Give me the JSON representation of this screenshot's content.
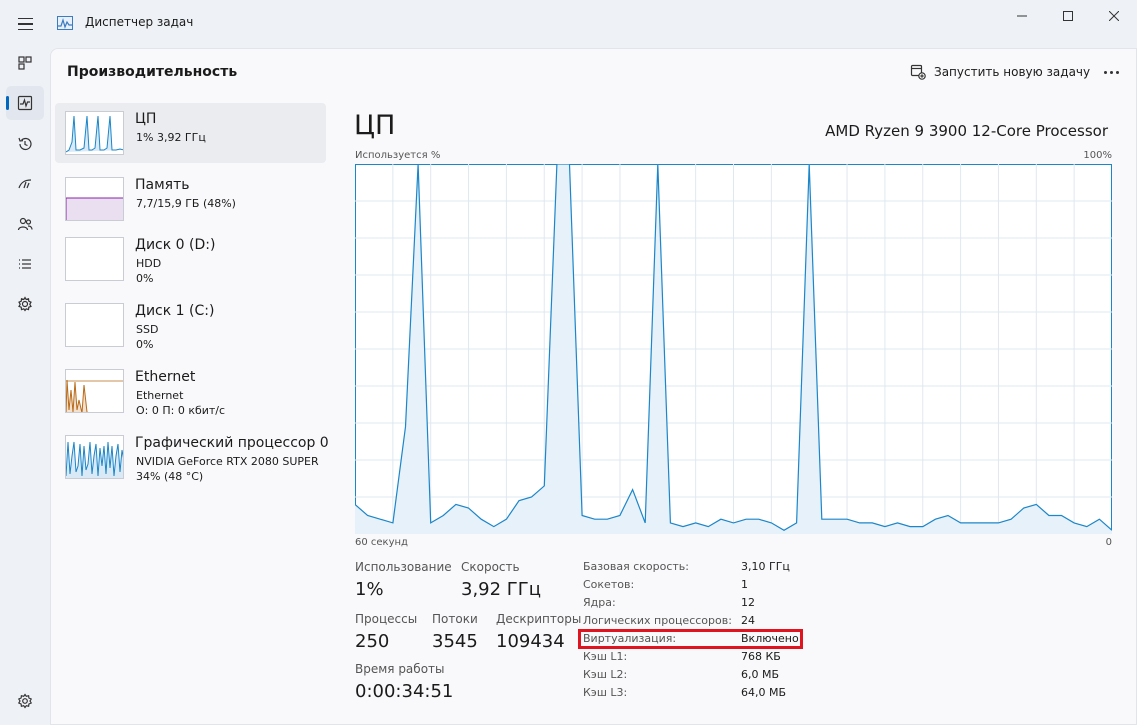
{
  "window": {
    "title": "Диспетчер задач"
  },
  "nav": {
    "items": [
      "processes-icon",
      "performance-icon",
      "app-history-icon",
      "startup-apps-icon",
      "users-icon",
      "details-icon",
      "services-icon"
    ],
    "active": "performance-icon",
    "settings": "settings-icon"
  },
  "header": {
    "title": "Производительность",
    "run_new_task": "Запустить новую задачу"
  },
  "devices": [
    {
      "name": "ЦП",
      "line1": "1% 3,92 ГГц",
      "line2": ""
    },
    {
      "name": "Память",
      "line1": "7,7/15,9 ГБ (48%)",
      "line2": ""
    },
    {
      "name": "Диск 0 (D:)",
      "line1": "HDD",
      "line2": "0%"
    },
    {
      "name": "Диск 1 (C:)",
      "line1": "SSD",
      "line2": "0%"
    },
    {
      "name": "Ethernet",
      "line1": "Ethernet",
      "line2": "О: 0 П: 0 кбит/с"
    },
    {
      "name": "Графический процессор 0",
      "line1": "NVIDIA GeForce RTX 2080 SUPER",
      "line2": "34% (48 °C)"
    }
  ],
  "cpu": {
    "title": "ЦП",
    "model": "AMD Ryzen 9 3900 12-Core Processor",
    "chart_top_left": "Используется %",
    "chart_top_right": "100%",
    "chart_bottom_left": "60 секунд",
    "chart_bottom_right": "0"
  },
  "stats": {
    "usage_label": "Использование",
    "usage_value": "1%",
    "speed_label": "Скорость",
    "speed_value": "3,92 ГГц",
    "processes_label": "Процессы",
    "processes_value": "250",
    "threads_label": "Потоки",
    "threads_value": "3545",
    "handles_label": "Дескрипторы",
    "handles_value": "109434",
    "uptime_label": "Время работы",
    "uptime_value": "0:00:34:51"
  },
  "specs": [
    {
      "key": "Базовая скорость:",
      "value": "3,10 ГГц"
    },
    {
      "key": "Сокетов:",
      "value": "1"
    },
    {
      "key": "Ядра:",
      "value": "12"
    },
    {
      "key": "Логических процессоров:",
      "value": "24"
    },
    {
      "key": "Виртуализация:",
      "value": "Включено"
    },
    {
      "key": "Кэш L1:",
      "value": "768 КБ"
    },
    {
      "key": "Кэш L2:",
      "value": "6,0 МБ"
    },
    {
      "key": "Кэш L3:",
      "value": "64,0 МБ"
    }
  ],
  "colors": {
    "cpu_line": "#1b86c9",
    "memory_line": "#8b22a8",
    "ethernet_line": "#b96a19",
    "highlight": "#e0141e",
    "accent": "#0067c0"
  },
  "chart_data": {
    "type": "area",
    "title": "",
    "xlabel": "60 секунд",
    "ylabel": "Используется %",
    "xlim": [
      60,
      0
    ],
    "ylim": [
      0,
      100
    ],
    "grid": true,
    "series": [
      {
        "values": [
          8,
          5,
          4,
          3,
          29,
          100,
          3,
          5,
          8,
          7,
          4,
          2,
          4,
          9,
          10,
          13,
          100,
          100,
          5,
          4,
          4,
          5,
          12,
          3,
          100,
          3,
          2,
          3,
          2,
          4,
          3,
          4,
          4,
          3,
          1,
          3,
          100,
          4,
          4,
          4,
          3,
          3,
          2,
          3,
          2,
          2,
          4,
          5,
          3,
          3,
          3,
          3,
          4,
          7,
          8,
          5,
          5,
          3,
          2,
          4,
          1
        ]
      }
    ]
  }
}
